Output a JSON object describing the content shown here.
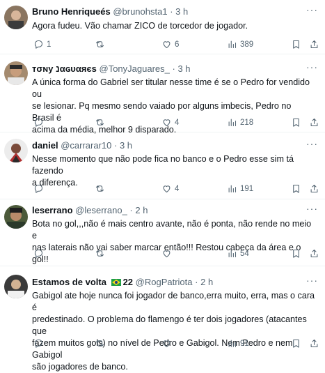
{
  "tweets": [
    {
      "name": "Bruno Henriqueés",
      "handle": "@brunohsta1",
      "sep": "·",
      "time": "3 h",
      "lines": [
        "Agora fudeu. Vão  chamar ZICO de torcedor de jogador."
      ],
      "replies": "1",
      "retweets": "",
      "likes": "6",
      "views": "389"
    },
    {
      "name": "тσɴу נαɢυαяєѕ",
      "handle": "@TonyJaguares_",
      "sep": "·",
      "time": "3 h",
      "lines": [
        "A única forma do Gabriel ser titular nesse time é se o Pedro for vendido ou",
        "se lesionar.  Pq mesmo sendo vaiado por alguns imbecis, Pedro no Brasil é",
        "acima da média, melhor 9 disparado."
      ],
      "replies": "",
      "retweets": "",
      "likes": "4",
      "views": "218"
    },
    {
      "name": "daniel",
      "handle": "@carrarar10",
      "sep": "·",
      "time": "3 h",
      "lines": [
        "Nesse momento que não pode fica no banco e o Pedro esse sim tá fazendo",
        "a diferença."
      ],
      "replies": "",
      "retweets": "",
      "likes": "4",
      "views": "191"
    },
    {
      "name": "leserrano",
      "handle": "@leserrano_",
      "sep": "·",
      "time": "2 h",
      "lines": [
        "Bota no gol,,,não é mais centro avante, não é ponta, não rende no meio e",
        "nas laterais não vai saber marcar então!!! Restou cabeça da área e o gol!!"
      ],
      "replies": "",
      "retweets": "",
      "likes": "",
      "views": "54"
    },
    {
      "name": "Estamos de volta",
      "name_suffix": "22",
      "handle": "@RogPatriota",
      "sep": "·",
      "time": "2 h",
      "lines": [
        "Gabigol ate hoje nunca foi jogador de banco,erra muito, erra, mas o cara é",
        "predestinado. O problema do flamengo é ter dois jogadores (atacantes que",
        "fazem muitos gols) no nível de Pedro e Gabigol. Nem Pedro e nem Gabigol",
        "são jogadores de banco."
      ],
      "replies": "",
      "retweets": "",
      "likes": "",
      "views": "91"
    }
  ],
  "more_label": "···",
  "icons": [
    "reply-icon",
    "retweet-icon",
    "like-icon",
    "views-icon",
    "bookmark-icon",
    "share-icon"
  ]
}
